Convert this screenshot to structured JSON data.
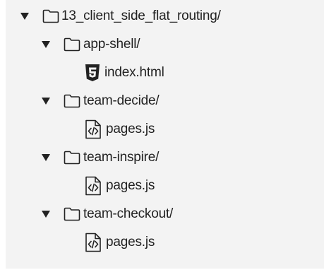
{
  "tree": {
    "root": {
      "label": "13_client_side_flat_routing/",
      "icon": "folder-icon",
      "expanded": true
    },
    "folders": [
      {
        "label": "app-shell/",
        "icon": "folder-icon",
        "expanded": true,
        "files": [
          {
            "label": "index.html",
            "icon": "html5-file-icon"
          }
        ]
      },
      {
        "label": "team-decide/",
        "icon": "folder-icon",
        "expanded": true,
        "files": [
          {
            "label": "pages.js",
            "icon": "js-file-icon"
          }
        ]
      },
      {
        "label": "team-inspire/",
        "icon": "folder-icon",
        "expanded": true,
        "files": [
          {
            "label": "pages.js",
            "icon": "js-file-icon"
          }
        ]
      },
      {
        "label": "team-checkout/",
        "icon": "folder-icon",
        "expanded": true,
        "files": [
          {
            "label": "pages.js",
            "icon": "js-file-icon"
          }
        ]
      }
    ]
  },
  "colors": {
    "background": "#f3f3f3",
    "text": "#222222",
    "icon": "#222222"
  }
}
